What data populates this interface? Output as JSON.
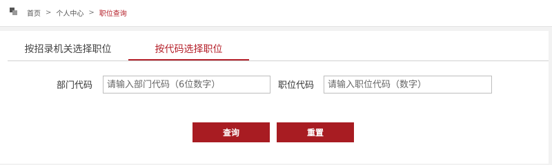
{
  "breadcrumb": {
    "home": "首页",
    "separator": ">",
    "center": "个人中心",
    "current": "职位查询"
  },
  "tabs": [
    {
      "label": "按招录机关选择职位",
      "active": false
    },
    {
      "label": "按代码选择职位",
      "active": true
    }
  ],
  "form": {
    "dept_code_label": "部门代码",
    "dept_code_placeholder": "请输入部门代码（6位数字）",
    "dept_code_value": "",
    "position_code_label": "职位代码",
    "position_code_placeholder": "请输入职位代码（数字）",
    "position_code_value": ""
  },
  "buttons": {
    "search": "查询",
    "reset": "重置"
  },
  "colors": {
    "accent": "#b5202a",
    "button": "#a81c22",
    "background": "#f2f2f2"
  }
}
